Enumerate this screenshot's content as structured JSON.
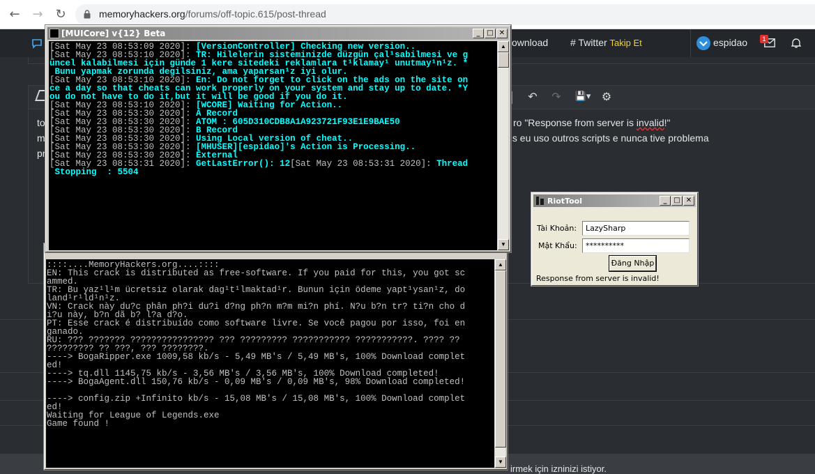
{
  "browser": {
    "back_icon": "←",
    "forward_icon": "→",
    "reload_icon": "↻",
    "url_host": "memoryhackers.org",
    "url_path": "/forums/off-topic.615/post-thread"
  },
  "forum": {
    "nav": {
      "download_label": "ownload",
      "twitter_label": "# Twitter",
      "twitter_cta": "Takip Et",
      "username": "espidao",
      "notification_count": "1"
    },
    "toolbar": {
      "undo_icon": "↶",
      "redo_icon": "↷",
      "save_icon": "💾▾",
      "settings_icon": "⚙"
    },
    "post_lines": [
      "to",
      "m",
      "pr"
    ],
    "post_right": {
      "line1_prefix": "ro \"Response from server is ",
      "line1_underlined": "invalid",
      "line1_suffix": "!\"",
      "line2": "ois eu uso outros scripts  e nunca tive problema"
    },
    "footer_text": "irmek için izninizi istiyor."
  },
  "muicore": {
    "title": "[MUICore] v{12} Beta",
    "lines": [
      {
        "ts": "[Sat May 23 08:53:09 2020]: ",
        "msg": "[VersionController] Checking new version.."
      },
      {
        "ts": "[Sat May 23 08:53:10 2020]: ",
        "msg": "TR: Hilelerin sisteminizde düzgün çal¹sabilmesi ve g"
      },
      {
        "ts": "",
        "msg": "üncel kalabilmesi için günde 1 kere sitedeki reklamlara t¹klamay¹ unutmay¹n¹z. *"
      },
      {
        "ts": "",
        "msg": " Bunu yapmak zorunda degilsiniz, ama yaparsan¹z iyi olur."
      },
      {
        "ts": "[Sat May 23 08:53:10 2020]: ",
        "msg": "En: Do not forget to click on the ads on the site on"
      },
      {
        "ts": "",
        "msg": "ce a day so that cheats can work properly on your system and stay up to date. *Y"
      },
      {
        "ts": "",
        "msg": "ou do not have to do it,but it will be good if you do it."
      },
      {
        "ts": "[Sat May 23 08:53:10 2020]: ",
        "msg": "[WCORE] Waiting for Action.."
      },
      {
        "ts": "[Sat May 23 08:53:30 2020]: ",
        "msg": "A Record"
      },
      {
        "ts": "[Sat May 23 08:53:30 2020]: ",
        "msg": "ATOM : 605D310CDB8A1A923721F93E1E9BAE50"
      },
      {
        "ts": "[Sat May 23 08:53:30 2020]: ",
        "msg": "B Record"
      },
      {
        "ts": "[Sat May 23 08:53:30 2020]: ",
        "msg": "Using Local version of cheat.."
      },
      {
        "ts": "[Sat May 23 08:53:30 2020]: ",
        "msg": "[MHUSER][espidao]'s Action is Processing.."
      },
      {
        "ts": "[Sat May 23 08:53:30 2020]: ",
        "msg": "External"
      },
      {
        "ts": "[Sat May 23 08:53:31 2020]: ",
        "msg": "GetLastError(): 12",
        "ts2": "[Sat May 23 08:53:31 2020]: ",
        "msg2": "Thread"
      },
      {
        "ts": "",
        "msg": " Stopping  : 5504"
      }
    ]
  },
  "crack_console": {
    "lines": [
      "::::....MemoryHackers.org....::::",
      "EN: This crack is distributed as free-software. If you paid for this, you got sc",
      "ammed.",
      "TR: Bu yaz¹l¹m ücretsiz olarak dag¹t¹lmaktad¹r. Bunun için ödeme yapt¹ysan¹z, do",
      "land¹r¹ld¹n¹z.",
      "VN: Crack này du?c phân ph?i du?i d?ng ph?n m?m mi?n phí. N?u b?n tr? ti?n cho d",
      "i?u này, b?n dã b? l?a d?o.",
      "PT: Esse crack é distribuído como software livre. Se você pagou por isso, foi en",
      "ganado.",
      "RU: ??? ??????? ???????????????? ??? ????????? ??????????? ???????????. ???? ??",
      "????????? ?? ???, ??? ????????.",
      "----> BogaRipper.exe 1009,58 kb/s - 5,49 MB's / 5,49 MB's, 100% Download complet",
      "ed!",
      "----> tq.dll 1145,75 kb/s - 3,56 MB's / 3,56 MB's, 100% Download completed!",
      "----> BogaAgent.dll 150,76 kb/s - 0,09 MB's / 0,09 MB's, 98% Download completed!",
      "",
      "----> config.zip +Infinito kb/s - 15,08 MB's / 15,08 MB's, 100% Download complet",
      "ed!",
      "Waiting for League of Legends.exe",
      "Game found !"
    ]
  },
  "riottool": {
    "title": "RiotTool",
    "account_label": "Tài Khoản:",
    "account_value": "LazySharp",
    "password_label": "Mật Khẩu:",
    "password_value": "**********",
    "login_button": "Đăng Nhập",
    "status": "Response from server is invalid!"
  },
  "window_controls": {
    "minimize": "_",
    "maximize": "□",
    "close": "✕"
  }
}
